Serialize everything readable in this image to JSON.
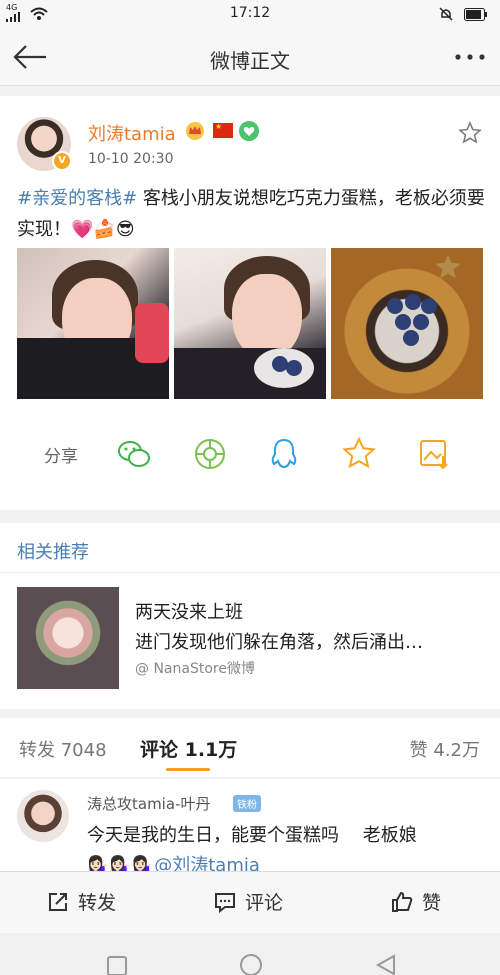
{
  "status_bar": {
    "network": "4G",
    "time": "17:12"
  },
  "header": {
    "title": "微博正文"
  },
  "post": {
    "username": "刘涛tamia",
    "time": "10-10 20:30",
    "hashtag": "#亲爱的客栈#",
    "text": " 客栈小朋友说想吃巧克力蛋糕，老板必须要实现！",
    "emoji": "💗🍰😎"
  },
  "share": {
    "label": "分享",
    "icons": [
      "wechat-icon",
      "moments-icon",
      "qq-icon",
      "favorite-icon",
      "save-image-icon"
    ]
  },
  "related": {
    "title": "相关推荐",
    "item": {
      "line1": "两天没来上班",
      "line2": "进门发现他们躲在角落，然后涌出…",
      "source": "@ NanaStore微博"
    }
  },
  "tabs": {
    "repost": "转发 7048",
    "comment": "评论 1.1万",
    "like": "赞 4.2万"
  },
  "comment": {
    "name": "涛总攻tamia-叶丹",
    "badge": "铁粉",
    "text": "今天是我的生日，能要个蛋糕吗　 老板娘",
    "text2": "💁🏻‍♀️💁🏻‍♀️💁🏻‍♀️@刘涛tamia"
  },
  "actions": {
    "repost": "转发",
    "comment": "评论",
    "like": "赞"
  },
  "colors": {
    "accent": "#f59b2e",
    "link": "#4a7fb5",
    "username": "#ea7b2b"
  }
}
